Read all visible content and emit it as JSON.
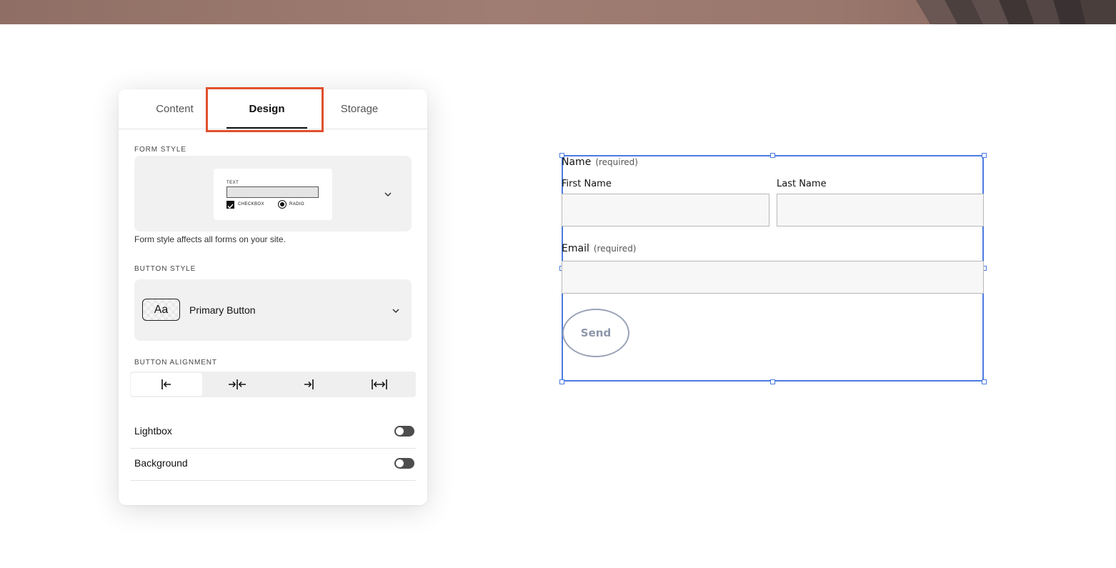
{
  "panel": {
    "tabs": [
      {
        "label": "Content"
      },
      {
        "label": "Design"
      },
      {
        "label": "Storage"
      }
    ],
    "active_tab": "Design",
    "form_style": {
      "section_label": "FORM STYLE",
      "preview": {
        "text": "TEXT",
        "checkbox": "CHECKBOX",
        "radio": "RADIO"
      },
      "helper": "Form style affects all forms on your site."
    },
    "button_style": {
      "section_label": "BUTTON STYLE",
      "swatch": "Aa",
      "value": "Primary Button"
    },
    "button_alignment": {
      "section_label": "BUTTON ALIGNMENT",
      "options": [
        "align-left-icon",
        "align-center-icon",
        "align-right-icon",
        "align-stretch-icon"
      ],
      "selected": "align-left-icon"
    },
    "toggles": [
      {
        "label": "Lightbox",
        "on": false
      },
      {
        "label": "Background",
        "on": false
      }
    ]
  },
  "form": {
    "name_label": "Name",
    "name_required": "(required)",
    "first_name_label": "First Name",
    "last_name_label": "Last Name",
    "email_label": "Email",
    "email_required": "(required)",
    "send_label": "Send"
  },
  "colors": {
    "highlight": "#e0502c",
    "selection": "#4a7be0"
  }
}
